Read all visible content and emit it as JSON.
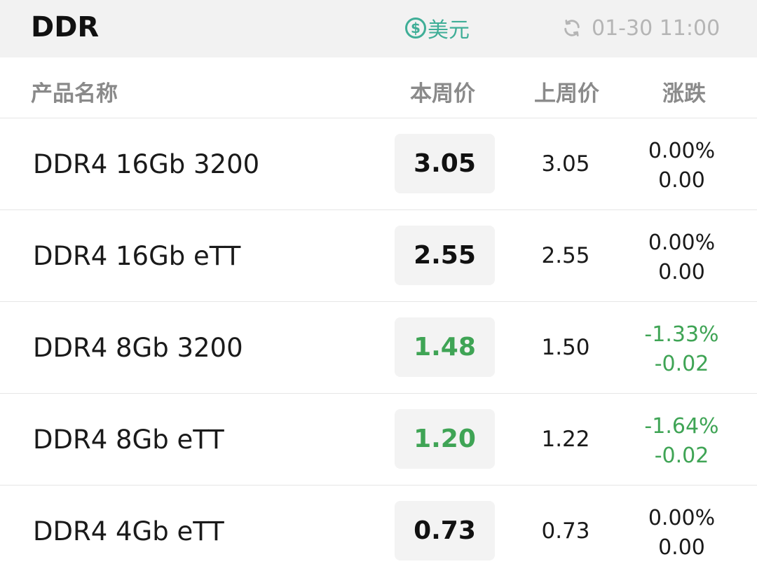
{
  "header": {
    "title": "DDR",
    "currency_symbol": "$",
    "currency_label": "美元",
    "updated_time": "01-30 11:00",
    "accent_color": "#3fae97"
  },
  "columns": {
    "name": "产品名称",
    "this_week": "本周价",
    "last_week": "上周价",
    "change": "涨跌"
  },
  "rows": [
    {
      "name": "DDR4 16Gb 3200",
      "this_week": "3.05",
      "last_week": "3.05",
      "change_pct": "0.00%",
      "change_abs": "0.00",
      "trend": "flat"
    },
    {
      "name": "DDR4 16Gb eTT",
      "this_week": "2.55",
      "last_week": "2.55",
      "change_pct": "0.00%",
      "change_abs": "0.00",
      "trend": "flat"
    },
    {
      "name": "DDR4 8Gb 3200",
      "this_week": "1.48",
      "last_week": "1.50",
      "change_pct": "-1.33%",
      "change_abs": "-0.02",
      "trend": "down"
    },
    {
      "name": "DDR4 8Gb eTT",
      "this_week": "1.20",
      "last_week": "1.22",
      "change_pct": "-1.64%",
      "change_abs": "-0.02",
      "trend": "down"
    },
    {
      "name": "DDR4 4Gb eTT",
      "this_week": "0.73",
      "last_week": "0.73",
      "change_pct": "0.00%",
      "change_abs": "0.00",
      "trend": "flat"
    }
  ],
  "colors": {
    "down": "#3fa455",
    "flat": "#1a1a1a"
  }
}
